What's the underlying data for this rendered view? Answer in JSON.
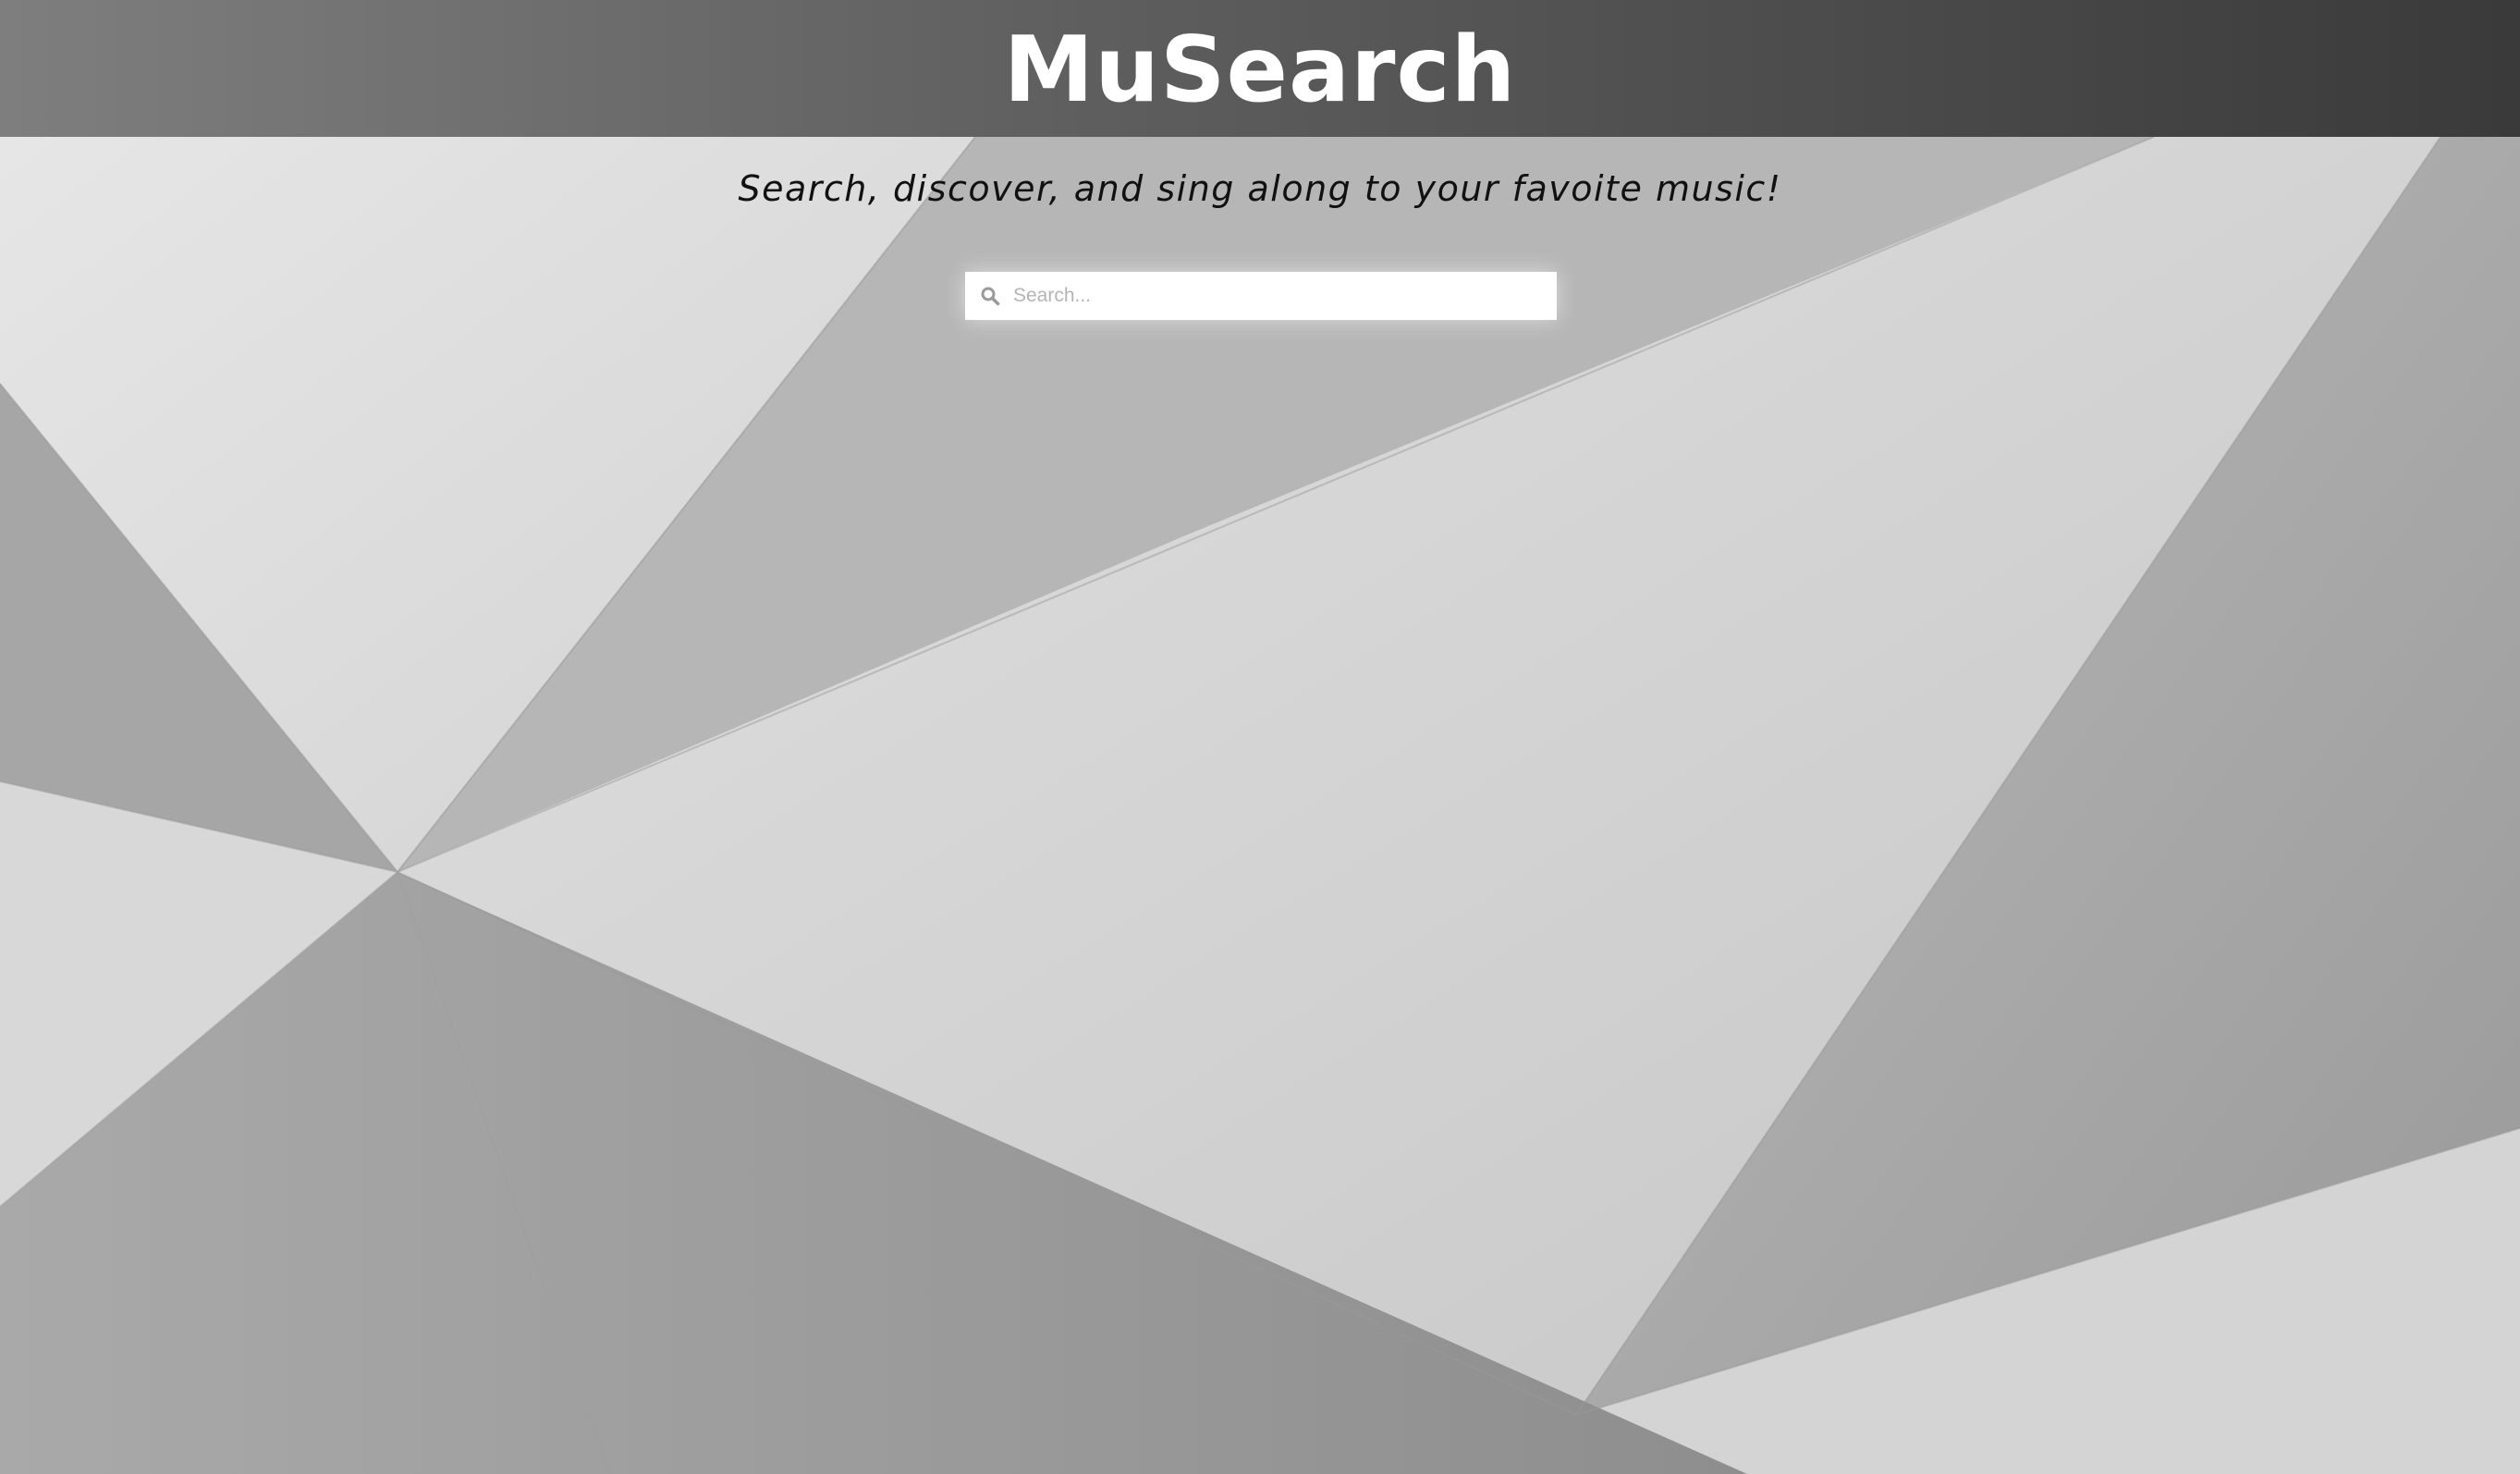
{
  "header": {
    "logo_text": "MuSearch"
  },
  "hero": {
    "tagline": "Search, discover, and sing along to your favoite music!"
  },
  "search": {
    "placeholder": "Search...",
    "value": "",
    "icon": "search-icon"
  },
  "colors": {
    "header_gradient_start": "#7e7e7e",
    "header_gradient_end": "#3a3a3a",
    "logo": "#ffffff",
    "tagline": "#111111"
  }
}
